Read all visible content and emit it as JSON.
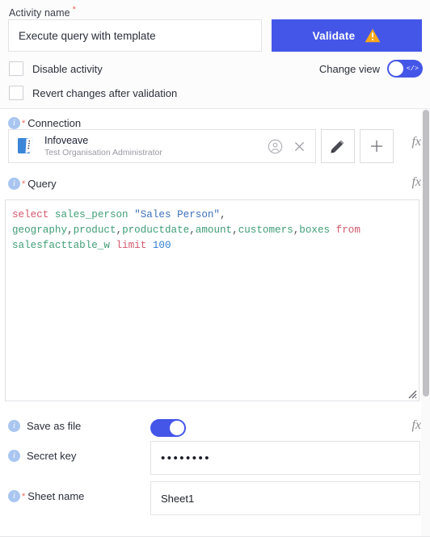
{
  "header": {
    "activity_label": "Activity name",
    "required_mark": "*",
    "activity_value": "Execute query with template",
    "activity_placeholder": "Activity name",
    "validate_label": "Validate",
    "warning_icon": "warning-triangle-icon",
    "checkboxes": [
      {
        "label": "Disable activity",
        "checked": false
      },
      {
        "label": "Revert changes after validation",
        "checked": false
      }
    ],
    "change_view_label": "Change view",
    "change_view_on": true,
    "change_view_icon": "</>"
  },
  "connection": {
    "label": "Connection",
    "required_mark": "*",
    "info_icon": "i",
    "name": "Infoveave",
    "subtitle": "Test Organisation Administrator",
    "account_icon": "user-circle-icon",
    "clear_icon": "close-icon",
    "edit_icon": "pencil-icon",
    "add_icon": "plus-icon",
    "fx_label": "fx"
  },
  "query": {
    "label": "Query",
    "required_mark": "*",
    "info_icon": "i",
    "fx_label": "fx",
    "text": "select sales_person \"Sales Person\",\ngeography,product,productdate,amount,customers,boxes from\nsalesfacttable_w limit 100",
    "tokens": [
      {
        "t": "select",
        "c": "kw"
      },
      {
        "t": " ",
        "c": "pun"
      },
      {
        "t": "sales_person",
        "c": "idn"
      },
      {
        "t": " ",
        "c": "pun"
      },
      {
        "t": "\"Sales Person\"",
        "c": "str"
      },
      {
        "t": ",",
        "c": "pun"
      },
      {
        "t": "\n",
        "c": "pun"
      },
      {
        "t": "geography",
        "c": "idn"
      },
      {
        "t": ",",
        "c": "pun"
      },
      {
        "t": "product",
        "c": "idn"
      },
      {
        "t": ",",
        "c": "pun"
      },
      {
        "t": "productdate",
        "c": "idn"
      },
      {
        "t": ",",
        "c": "pun"
      },
      {
        "t": "amount",
        "c": "idn"
      },
      {
        "t": ",",
        "c": "pun"
      },
      {
        "t": "customers",
        "c": "idn"
      },
      {
        "t": ",",
        "c": "pun"
      },
      {
        "t": "boxes",
        "c": "idn"
      },
      {
        "t": " ",
        "c": "pun"
      },
      {
        "t": "from",
        "c": "kw"
      },
      {
        "t": "\n",
        "c": "pun"
      },
      {
        "t": "salesfacttable_w",
        "c": "idn"
      },
      {
        "t": " ",
        "c": "pun"
      },
      {
        "t": "limit",
        "c": "kw"
      },
      {
        "t": " ",
        "c": "pun"
      },
      {
        "t": "100",
        "c": "num"
      }
    ]
  },
  "fields": {
    "save_as_file": {
      "label": "Save as file",
      "info_icon": "i",
      "enabled": true,
      "fx_label": "fx"
    },
    "secret_key": {
      "label": "Secret key",
      "info_icon": "i",
      "value": "••••••••",
      "placeholder": "Secret key"
    },
    "sheet_name": {
      "label": "Sheet name",
      "required_mark": "*",
      "info_icon": "i",
      "value": "Sheet1",
      "placeholder": "Sheet name"
    }
  },
  "colors": {
    "accent": "#4456e8",
    "warning": "#f7a71c",
    "required": "#f2655c",
    "info": "#a9c6f0",
    "keyword": "#d2586d",
    "identifier": "#3f9e75",
    "string": "#3d6fba",
    "number": "#2f7fd1"
  }
}
